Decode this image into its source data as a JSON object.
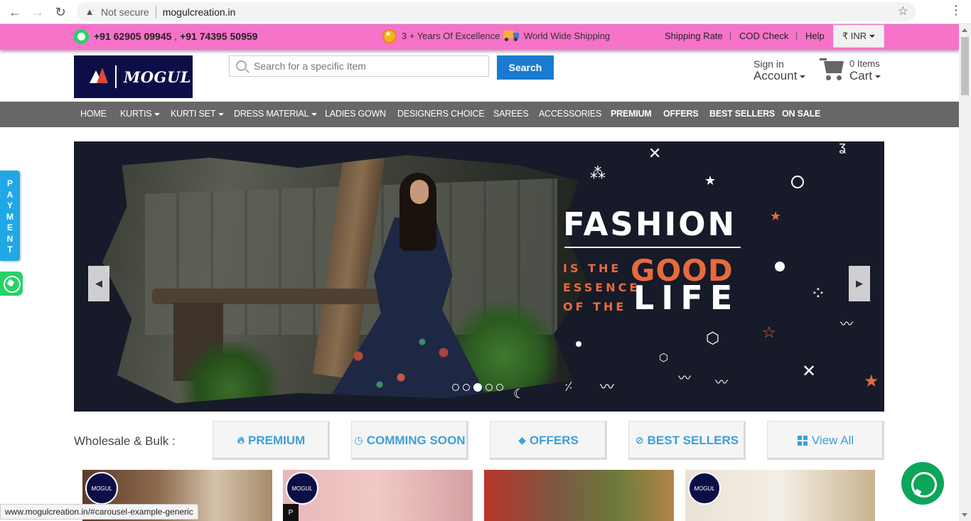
{
  "browser": {
    "security_label": "Not secure",
    "url": "mogulcreation.in",
    "status_url": "www.mogulcreation.in/#carousel-example-generic"
  },
  "topbar": {
    "phone1": "+91 62905 09945",
    "phone2": "+91 74395 50959",
    "excellence": "3 + Years Of Excellence",
    "shipping": "World Wide Shipping",
    "links": [
      "Shipping Rate",
      "COD Check",
      "Help"
    ],
    "currency": "₹ INR"
  },
  "header": {
    "logo_text": "MOGUL",
    "search_placeholder": "Search for a specific Item",
    "search_button": "Search",
    "signin": "Sign in",
    "account": "Account",
    "items": "0 Items",
    "cart": "Cart"
  },
  "nav": {
    "items": [
      {
        "label": "HOME",
        "dropdown": false
      },
      {
        "label": "KURTIS",
        "dropdown": true
      },
      {
        "label": "KURTI SET",
        "dropdown": true
      },
      {
        "label": "DRESS MATERIAL",
        "dropdown": true
      },
      {
        "label": "LADIES GOWN",
        "dropdown": false
      },
      {
        "label": "DESIGNERS CHOICE",
        "dropdown": false
      },
      {
        "label": "SAREES",
        "dropdown": false
      },
      {
        "label": "ACCESSORIES",
        "dropdown": false
      },
      {
        "label": "PREMIUM",
        "dropdown": false
      },
      {
        "label": "OFFERS",
        "dropdown": false
      },
      {
        "label": "BEST SELLERS",
        "dropdown": false
      },
      {
        "label": "ON SALE",
        "dropdown": false
      }
    ]
  },
  "banner": {
    "headline": "FASHION",
    "line1": "IS THE",
    "line2": "ESSENCE",
    "line3": "OF THE",
    "good": "GOOD",
    "life": "LIFE",
    "slides_total": 5,
    "active_slide": 3
  },
  "payment_tab": "PAYMENT",
  "wholesale": {
    "label": "Wholesale & Bulk :",
    "buttons": [
      {
        "label": "PREMIUM",
        "icon": "fire-icon"
      },
      {
        "label": "COMMING SOON",
        "icon": "clock-icon"
      },
      {
        "label": "OFFERS",
        "icon": "tag-icon"
      },
      {
        "label": "BEST SELLERS",
        "icon": "ban-icon"
      },
      {
        "label": "View All",
        "icon": "grid-icon"
      }
    ]
  },
  "products": {
    "badge": "MOGUL",
    "p2_logo": "P"
  },
  "colors": {
    "topbar": "#f772c9",
    "navbar": "#676767",
    "accent": "#1a7bd1",
    "link_blue": "#3d9fd9",
    "banner_bg": "#171a29",
    "banner_orange": "#e86a3b"
  }
}
